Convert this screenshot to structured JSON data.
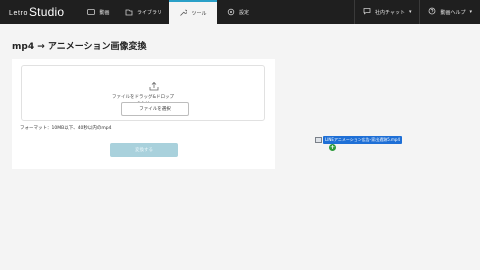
{
  "app": {
    "logo_small": "Letro",
    "logo_big": "Studio"
  },
  "nav": {
    "items": [
      {
        "label": "動画",
        "icon": "video-icon"
      },
      {
        "label": "ライブラリ",
        "icon": "library-icon"
      },
      {
        "label": "ツール",
        "icon": "tool-icon",
        "active": true
      },
      {
        "label": "設定",
        "icon": "settings-icon"
      }
    ],
    "chat": {
      "label": "社内チャット",
      "icon": "chat-icon"
    },
    "help": {
      "label": "動画ヘルプ",
      "icon": "help-icon"
    }
  },
  "page": {
    "title": "mp4 → アニメーション画像変換",
    "dropzone": {
      "line1": "ファイルをドラッグ&ドロップ",
      "line2": "または",
      "select_button": "ファイルを選択"
    },
    "format_note": "フォーマット：10MB以下、40秒以内のmp4",
    "convert_button": "変換する"
  },
  "drag": {
    "file_name": "LINEアニメーション広告-家出遺跡5.mp4",
    "plus": "+"
  },
  "colors": {
    "accent": "#2aa0c8",
    "topbar": "#1f1f1f",
    "drag_chip": "#1e6fd6",
    "convert_disabled": "#a9d1dc"
  }
}
